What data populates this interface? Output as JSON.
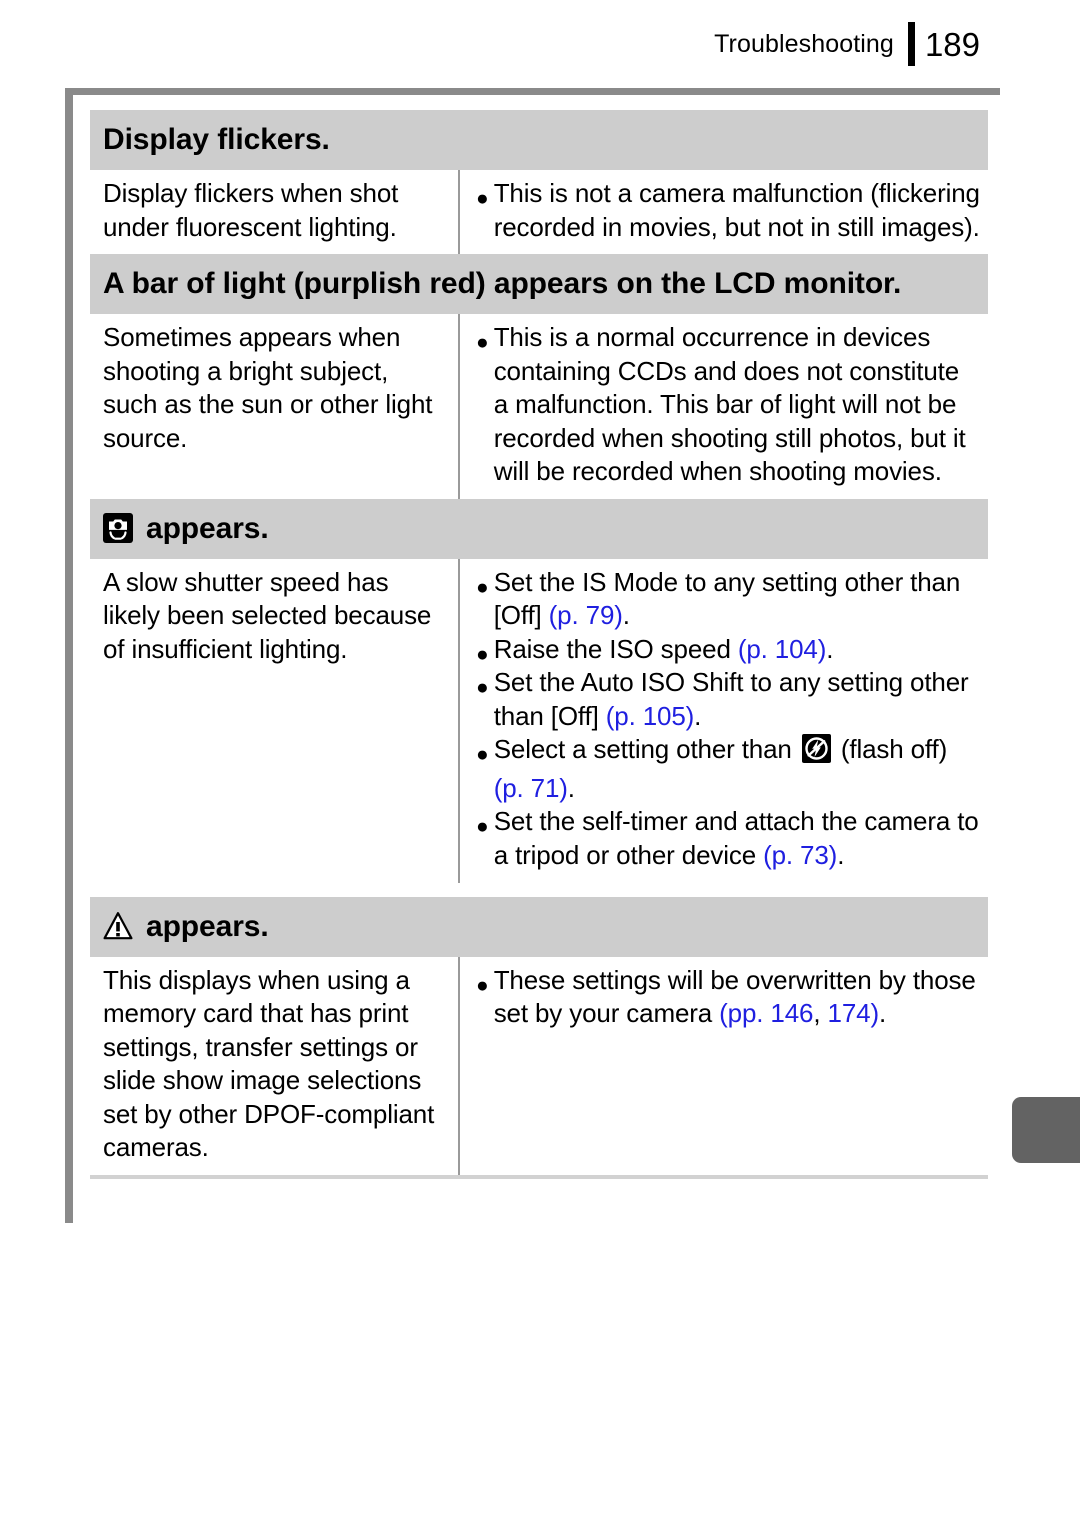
{
  "header": {
    "chapter": "Troubleshooting",
    "page_number": "189"
  },
  "colors": {
    "section_band": "#cdcdcd",
    "frame_rule": "#8a8a8a",
    "page_reference_link": "#1f1fe0",
    "thumb_tab": "#636363"
  },
  "sections": [
    {
      "id": "display-flickers",
      "icon": null,
      "title": "Display flickers.",
      "cause": "Display flickers when shot under fluorescent lighting.",
      "bullets": [
        {
          "text": "This is not a camera malfunction (flickering recorded in movies, but not in still images)."
        }
      ]
    },
    {
      "id": "bar-of-light",
      "icon": null,
      "title": "A bar of light (purplish red) appears on the LCD monitor.",
      "cause": "Sometimes appears when shooting a bright subject, such as the sun or other light source.",
      "bullets": [
        {
          "text": "This is a normal occurrence in devices containing CCDs and does not constitute a malfunction. This bar of light will not be recorded when shooting still photos, but it will be recorded when shooting movies."
        }
      ]
    },
    {
      "id": "camera-shake-warning",
      "icon": "camera-shake-warning-icon",
      "title": "appears.",
      "cause": "A slow shutter speed has likely been selected because of insufficient lighting.",
      "bullets": [
        {
          "parts": [
            {
              "type": "text",
              "value": "Set the IS Mode to any setting other than [Off] "
            },
            {
              "type": "ref",
              "value": "(p. 79)"
            },
            {
              "type": "text",
              "value": "."
            }
          ]
        },
        {
          "parts": [
            {
              "type": "text",
              "value": "Raise the ISO speed "
            },
            {
              "type": "ref",
              "value": "(p. 104)"
            },
            {
              "type": "text",
              "value": "."
            }
          ]
        },
        {
          "parts": [
            {
              "type": "text",
              "value": "Set the Auto ISO Shift to any setting other than [Off] "
            },
            {
              "type": "ref",
              "value": "(p. 105)"
            },
            {
              "type": "text",
              "value": "."
            }
          ]
        },
        {
          "parts": [
            {
              "type": "text",
              "value": "Select a setting other than "
            },
            {
              "type": "icon",
              "value": "flash-off-icon"
            },
            {
              "type": "text",
              "value": " (flash off) "
            },
            {
              "type": "ref",
              "value": "(p. 71)"
            },
            {
              "type": "text",
              "value": "."
            }
          ]
        },
        {
          "parts": [
            {
              "type": "text",
              "value": "Set the self-timer and attach the camera to a tripod or other device "
            },
            {
              "type": "ref",
              "value": "(p. 73)"
            },
            {
              "type": "text",
              "value": "."
            }
          ]
        }
      ]
    },
    {
      "id": "dpof-warning",
      "icon": "warning-triangle-icon",
      "title": "appears.",
      "cause": "This displays when using a memory card that has print settings, transfer settings or slide show image selections set by other DPOF-compliant cameras.",
      "bullets": [
        {
          "parts": [
            {
              "type": "text",
              "value": "These settings will be overwritten by those set by your camera "
            },
            {
              "type": "ref",
              "value": "(pp. 146"
            },
            {
              "type": "text",
              "value": ", "
            },
            {
              "type": "ref",
              "value": "174)"
            },
            {
              "type": "text",
              "value": "."
            }
          ]
        }
      ]
    }
  ]
}
